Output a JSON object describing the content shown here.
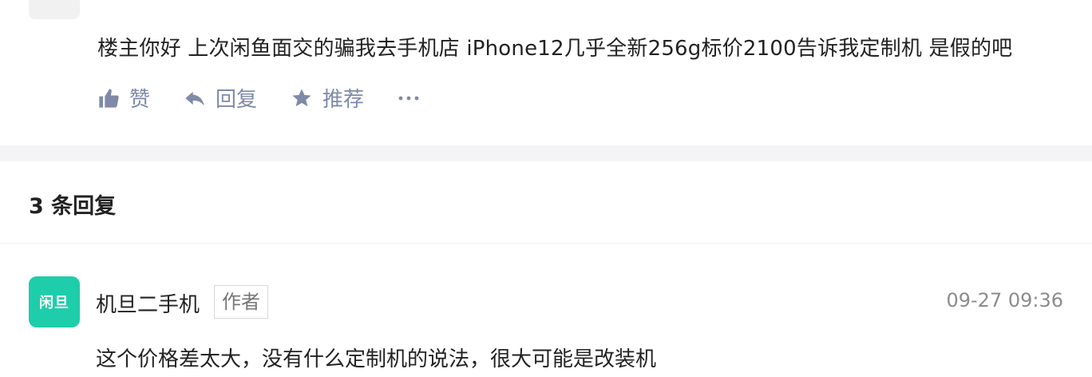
{
  "top_post": {
    "text": "楼主你好 上次闲鱼面交的骗我去手机店 iPhone12几乎全新256g标价2100告诉我定制机 是假的吧",
    "actions": {
      "like_label": "赞",
      "reply_label": "回复",
      "recommend_label": "推荐",
      "more_label": "···"
    }
  },
  "replies": {
    "count_label": "3 条回复",
    "items": [
      {
        "avatar_text": "闲旦",
        "name": "机旦二手机",
        "badge": "作者",
        "time": "09-27 09:36",
        "text": "这个价格差太大，没有什么定制机的说法，很大可能是改装机"
      }
    ]
  },
  "colors": {
    "action_gray": "#7f8aa8",
    "avatar_green": "#1ecdaa",
    "divider": "#f4f4f6"
  }
}
